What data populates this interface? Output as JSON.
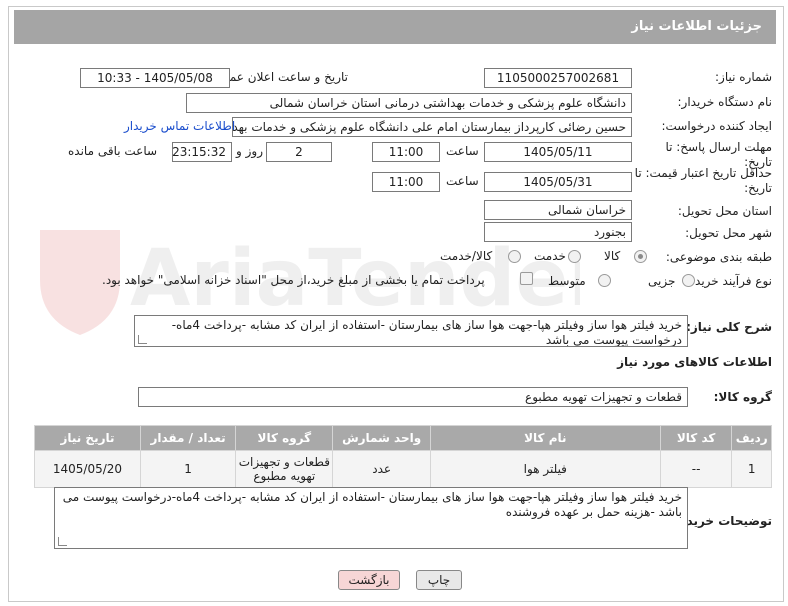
{
  "header": {
    "title": "جزئیات اطلاعات نیاز"
  },
  "fields": {
    "need_number_label": "شماره نیاز:",
    "need_number": "1105000257002681",
    "announce_label": "تاریخ و ساعت اعلان عمومی:",
    "announce_value": "1405/05/08 - 10:33",
    "buyer_org_label": "نام دستگاه خریدار:",
    "buyer_org": "دانشگاه علوم پزشکی و خدمات بهداشتی درمانی استان خراسان شمالی",
    "requester_label": "ایجاد کننده درخواست:",
    "requester": "حسین رضائی کارپرداز بیمارستان امام علی دانشگاه علوم پزشکی و خدمات بهد",
    "contact_link": "اطلاعات تماس خریدار",
    "deadline_label": "مهلت ارسال پاسخ: تا تاریخ:",
    "deadline_date": "1405/05/11",
    "time_label": "ساعت",
    "deadline_time": "11:00",
    "days_value": "2",
    "days_label": "روز و",
    "remaining_time": "23:15:32",
    "remaining_label": "ساعت باقی مانده",
    "validity_label": "حداقل تاریخ اعتبار قیمت: تا تاریخ:",
    "validity_date": "1405/05/31",
    "validity_time": "11:00",
    "province_label": "استان محل تحویل:",
    "province": "خراسان شمالی",
    "city_label": "شهر محل تحویل:",
    "city": "بجنورد",
    "category_label": "طبقه بندی موضوعی:",
    "category_options": [
      "کالا",
      "خدمت",
      "کالا/خدمت"
    ],
    "process_label": "نوع فرآیند خرید :",
    "process_options": [
      "جزیی",
      "متوسط"
    ],
    "payment_note": "پرداخت تمام یا بخشی از مبلغ خرید،از محل \"اسناد خزانه اسلامی\" خواهد بود.",
    "summary_label": "شرح کلی نیاز:",
    "summary": "خرید فیلتر هوا ساز  وفیلتر هپا-جهت هوا ساز های بیمارستان -استفاده از ایران کد مشابه -پرداخت 4ماه-درخواست پیوست می باشد",
    "goods_info_label": "اطلاعات کالاهای مورد نیاز",
    "goods_group_label": "گروه کالا:",
    "goods_group": "قطعات و تجهیزات تهویه مطبوع",
    "buyer_notes_label": "توضیحات خریدار:",
    "buyer_notes": "خرید فیلتر هوا ساز  وفیلتر هپا-جهت هوا ساز های بیمارستان -استفاده از ایران کد مشابه -پرداخت 4ماه-درخواست پیوست می باشد -هزینه حمل بر عهده فروشنده"
  },
  "table": {
    "headers": [
      "ردیف",
      "کد کالا",
      "نام کالا",
      "واحد شمارش",
      "گروه کالا",
      "تعداد / مقدار",
      "تاریخ نیاز"
    ],
    "rows": [
      [
        "1",
        "--",
        "فیلتر هوا",
        "عدد",
        "قطعات و تجهیزات تهویه مطبوع",
        "1",
        "1405/05/20"
      ]
    ]
  },
  "buttons": {
    "print": "چاپ",
    "back": "بازگشت"
  },
  "watermark": "AriaTender.net"
}
